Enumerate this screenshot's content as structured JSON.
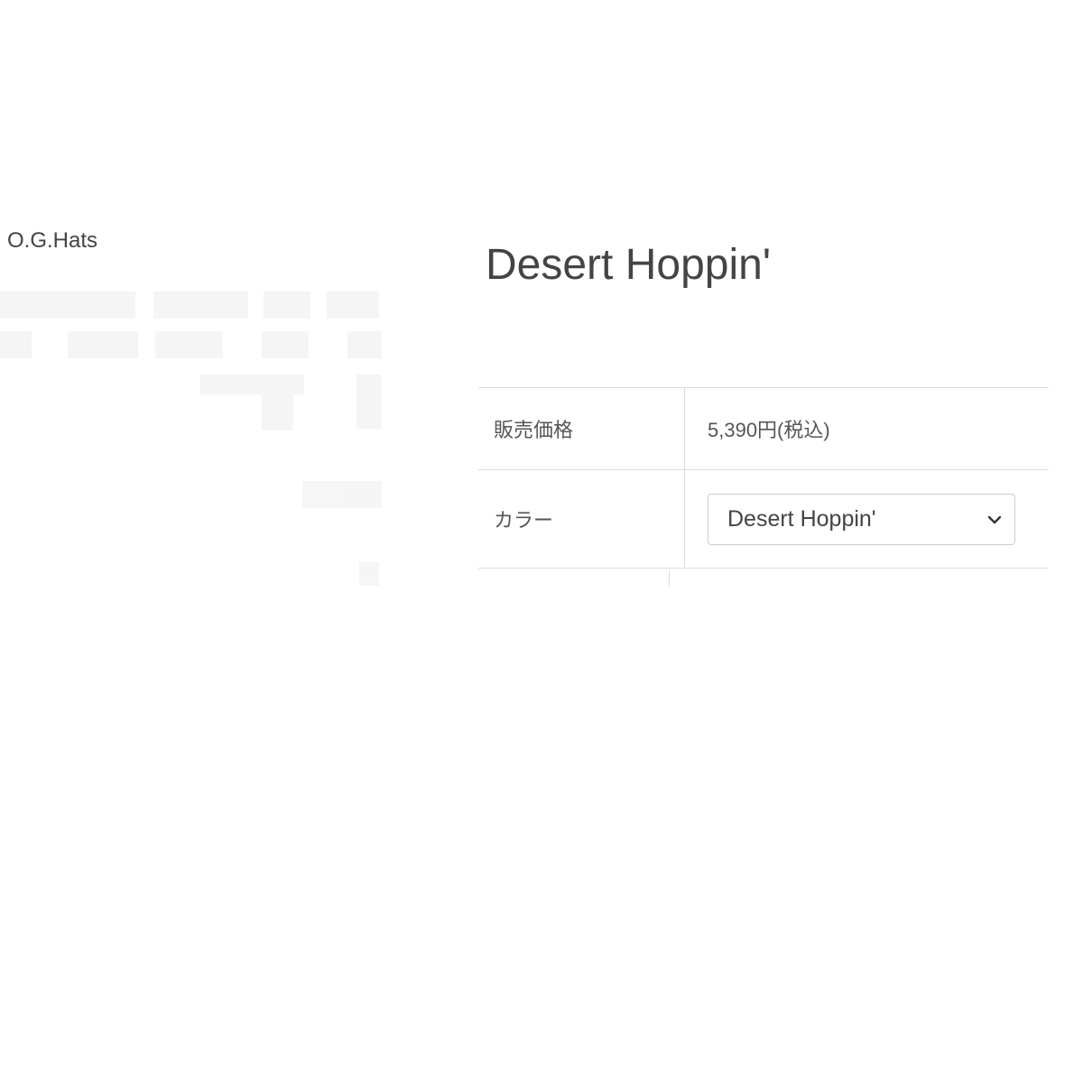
{
  "brand": {
    "name": "O.G.Hats"
  },
  "product": {
    "title": "Desert Hoppin'"
  },
  "specs": {
    "price_label": "販売価格",
    "price_value": "5,390円(税込)",
    "color_label": "カラー",
    "color_selected": "Desert Hoppin'"
  },
  "icons": {
    "select_arrow": "chevron-down-icon"
  },
  "colors": {
    "text": "#444444",
    "border": "#dddddd",
    "select_border": "#cccccc"
  }
}
